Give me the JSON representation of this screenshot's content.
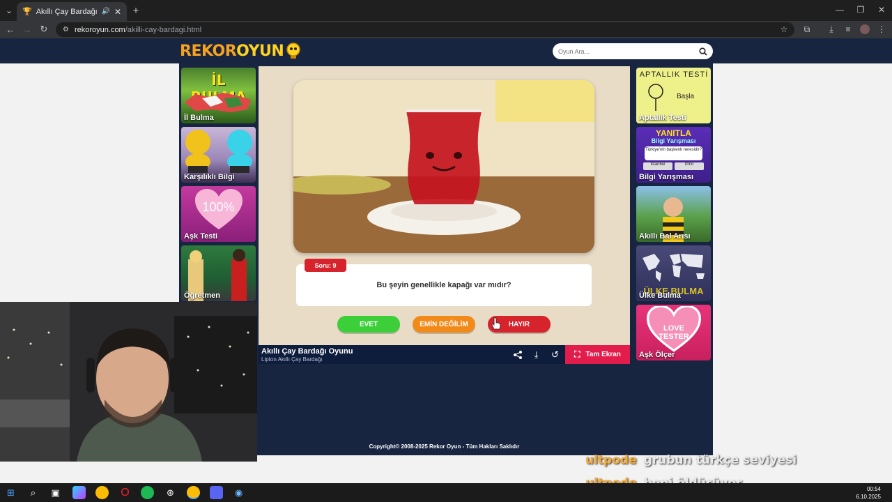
{
  "browser": {
    "tab_title": "Akıllı Çay Bardağı Oyunu O",
    "url_host": "rekoroyun.com",
    "url_path": "/akilli-cay-bardagi.html"
  },
  "site": {
    "logo_part1": "REKOR",
    "logo_part2": "OYUN",
    "search_placeholder": "Oyun Ara..."
  },
  "left_games": [
    {
      "label": "İl Bulma",
      "banner": "İL BULMA"
    },
    {
      "label": "Karşılıklı Bilgi"
    },
    {
      "label": "Aşk Testi",
      "banner": "100%"
    },
    {
      "label": "Öğretmen"
    }
  ],
  "right_games": [
    {
      "label": "Aptallık Testi",
      "banner": "APTALLIK TESTİ",
      "sub": "Başla"
    },
    {
      "label": "Bilgi Yarışması",
      "banner": "YANITLA",
      "banner2": "Bilgi Yarışması",
      "q": "Türkiye'nin başkenti neresidir?",
      "a1": "İstanbul",
      "a2": "İzmir"
    },
    {
      "label": "Akıllı Bal Arısı"
    },
    {
      "label": "Ülke Bulma",
      "banner": "ÜLKE BULMA"
    },
    {
      "label": "Aşk Ölçer",
      "banner": "LOVE TESTER"
    }
  ],
  "game": {
    "question_number": "Soru: 9",
    "question": "Bu şeyin genellikle kapağı var mıdır?",
    "answer_yes": "EVET",
    "answer_unsure": "EMİN DEĞİLİM",
    "answer_no": "HAYIR",
    "title": "Akıllı Çay Bardağı Oyunu",
    "subtitle": "Lipton Akıllı Çay Bardağı",
    "fullscreen_label": "Tam Ekran"
  },
  "copyright": "Copyright© 2008-2025 Rekor Oyun - Tüm Hakları Saklıdır",
  "chat": [
    {
      "name": "ultpode",
      "message": "grubun türkçe seviyesi"
    },
    {
      "name": "ultpode",
      "message": "beni öldürüyor"
    }
  ],
  "clock": {
    "time": "00:54",
    "date": "6.10.2025"
  },
  "colors": {
    "header_bg": "#172541",
    "evet": "#3ccf3a",
    "emin": "#f28a1a",
    "hayir": "#d6232c",
    "fullscreen": "#e21d4c"
  }
}
